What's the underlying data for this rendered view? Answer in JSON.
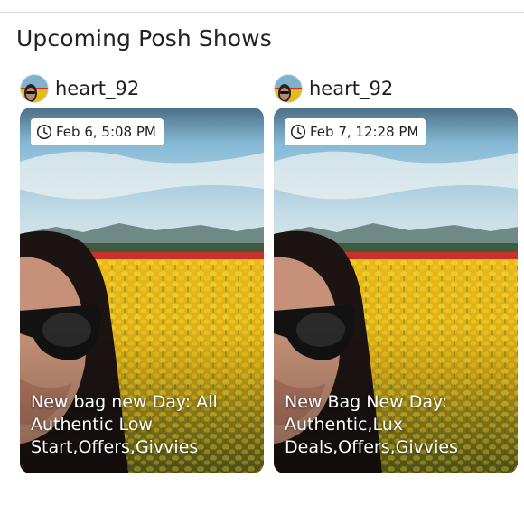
{
  "section": {
    "title": "Upcoming Posh Shows"
  },
  "shows": [
    {
      "host": "heart_92",
      "date": "Feb 6, 5:08 PM",
      "title": "New bag new Day: All Authentic Low Start,Offers,Givvies"
    },
    {
      "host": "heart_92",
      "date": "Feb 7, 12:28 PM",
      "title": "New Bag New Day: Authentic,Lux Deals,Offers,Givvies"
    }
  ],
  "icons": {
    "clock": "clock-icon",
    "avatar": "avatar"
  },
  "colors": {
    "sky": "#7fb2cf",
    "field_yellow": "#e8c21c",
    "field_red": "#c8322a",
    "badge_bg": "#ffffff"
  }
}
